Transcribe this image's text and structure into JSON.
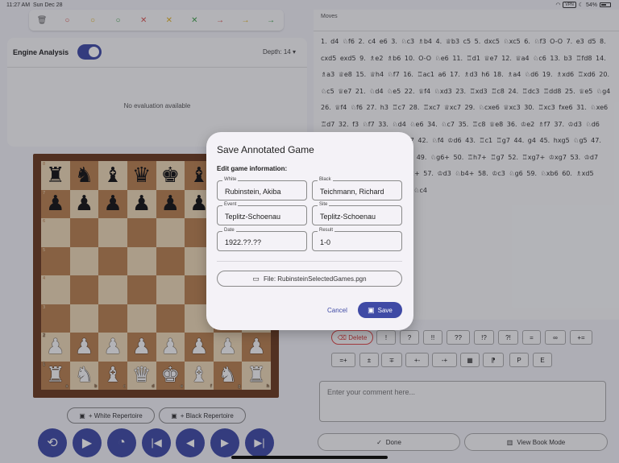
{
  "status_bar": {
    "time": "11:27 AM",
    "date": "Sun Dec 28",
    "vpn": "VPN",
    "battery": "54%"
  },
  "toolbar": {
    "icons": [
      "trash-icon",
      "circle-red-icon",
      "circle-yellow-icon",
      "circle-green-icon",
      "x-red-icon",
      "x-yellow-icon",
      "x-green-icon",
      "arrow-red-icon",
      "arrow-yellow-icon",
      "arrow-green-icon"
    ],
    "glyphs": [
      "🗑",
      "○",
      "○",
      "○",
      "✕",
      "✕",
      "✕",
      "→",
      "→",
      "→"
    ],
    "colors": [
      "#666666",
      "#d9534f",
      "#e0b020",
      "#3fa04a",
      "#d9534f",
      "#e0b020",
      "#3fa04a",
      "#d9534f",
      "#e0b020",
      "#3fa04a"
    ]
  },
  "engine": {
    "title": "Engine Analysis",
    "enabled": true,
    "depth_label": "Depth:",
    "depth_value": "14",
    "no_eval": "No evaluation available"
  },
  "board": {
    "rows": [
      [
        "♜",
        "♞",
        "♝",
        "♛",
        "♚",
        "♝",
        "♞",
        "♜"
      ],
      [
        "♟",
        "♟",
        "♟",
        "♟",
        "♟",
        "♟",
        "♟",
        "♟"
      ],
      [
        "",
        "",
        "",
        "",
        "",
        "",
        "",
        ""
      ],
      [
        "",
        "",
        "",
        "",
        "",
        "",
        "",
        ""
      ],
      [
        "",
        "",
        "",
        "",
        "",
        "",
        "",
        ""
      ],
      [
        "",
        "",
        "",
        "",
        "",
        "",
        "",
        ""
      ],
      [
        "♟",
        "♟",
        "♟",
        "♟",
        "♟",
        "♟",
        "♟",
        "♟"
      ],
      [
        "♜",
        "♞",
        "♝",
        "♛",
        "♚",
        "♝",
        "♞",
        "♜"
      ]
    ],
    "ranks": [
      "8",
      "7",
      "6",
      "5",
      "4",
      "3",
      "2",
      "1"
    ],
    "files": [
      "a",
      "b",
      "c",
      "d",
      "e",
      "f",
      "g",
      "h"
    ]
  },
  "repertoire": {
    "white": "+ White Repertoire",
    "black": "+ Black Repertoire"
  },
  "nav": [
    "⟲",
    "▶",
    "◔",
    "|◀",
    "◀",
    "▶",
    "▶|"
  ],
  "moves": {
    "header": "Moves",
    "text": "1. d4 ♘f6 2. c4 e6 3. ♘c3 ♗b4 4. ♕b3 c5 5. dxc5 ♘xc5 6. ♘f3 O-O 7. e3 d5 8. cxd5 exd5 9. ♗e2 ♗b6 10. O-O ♘e6 11. ♖d1 ♕e7 12. ♕a4 ♘c6 13. b3 ♖fd8 14. ♗a3 ♕e8 15. ♕h4 ♘f7 16. ♖ac1 a6 17. ♗d3 h6 18. ♗a4 ♘d6 19. ♗xd6 ♖xd6 20. ♘c5 ♕e7 21. ♘d4 ♘e5 22. ♕f4 ♘xd3 23. ♖xd3 ♖c8 24. ♖dc3 ♖dd8 25. ♕e5 ♘g4 26. ♕f4 ♘f6 27. h3 ♖c7 28. ♖xc7 ♕xc7 29. ♘cxe6 ♕xc3 30. ♖xc3 fxe6 31. ♘xe6 ♖d7 32. f3 ♘f7 33. ♘d4 ♘e6 34. ♘c7 35. ♖c8 ♕e8 36. ♔e2 ♗f7 37. ♔d3 ♘d6 38. ♖c5 ♘e8 39. ♘e2 ♘c7 42. ♘f4 ♔d6 43. ♖c1 ♖g7 44. g4 45. hxg5 ♘g5 47. hxg5 ♖xg5 48. ♖h6+ ♔e5 49. ♘g6+ 50. ♖h7+ ♖g7 52. ♖xg7+ ♔xg7 53. ♔d7 ♘a6 54. ♘d4 55. ♘c7 ♘c2+ 57. ♔d3 ♘b4+ 58. ♔c3 ♘g6 59. ♘xb6 60. ♗xd5 ♘xe3+ 62. ♔c5 ♘xg4 63. ♘c4"
  },
  "annotations": {
    "delete": "Delete",
    "row1": [
      "!",
      "?",
      "!!",
      "??",
      "!?",
      "?!",
      "=",
      "∞",
      "+="
    ],
    "row2": [
      "=+",
      "±",
      "∓",
      "+-",
      "-+",
      "▦",
      "⁋",
      "P",
      "E"
    ]
  },
  "comment": {
    "placeholder": "Enter your comment here..."
  },
  "bottom": {
    "done": "Done",
    "book": "View Book Mode"
  },
  "dialog": {
    "title": "Save Annotated Game",
    "subtitle": "Edit game information:",
    "white_label": "White",
    "white_value": "Rubinstein, Akiba",
    "black_label": "Black",
    "black_value": "Teichmann, Richard",
    "event_label": "Event",
    "event_value": "Teplitz-Schoenau",
    "site_label": "Site",
    "site_value": "Teplitz-Schoenau",
    "date_label": "Date",
    "date_value": "1922.??.??",
    "result_label": "Result",
    "result_value": "1-0",
    "file_button": "File: RubinsteinSelectedGames.pgn",
    "cancel": "Cancel",
    "save": "Save"
  },
  "colors": {
    "accent": "#3f4aa5",
    "board_light": "#eed9b6",
    "board_dark": "#b9804e"
  }
}
